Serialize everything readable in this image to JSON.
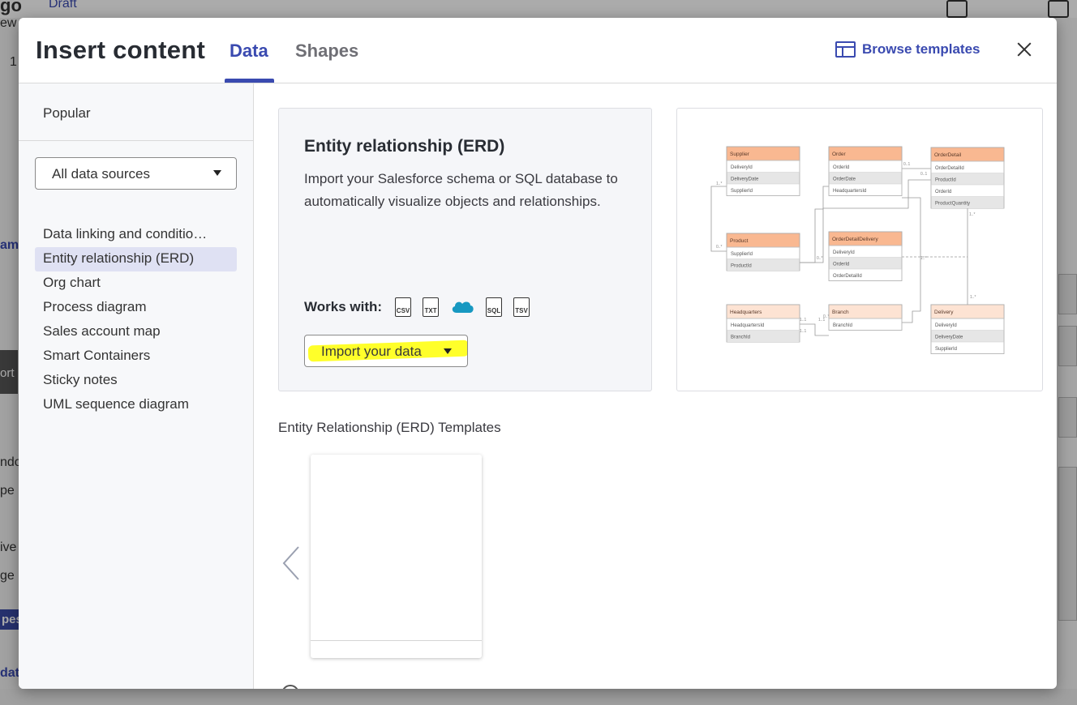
{
  "background": {
    "fragments": [
      "go",
      "Draft",
      "ew",
      "1",
      "am",
      "ort",
      "ndo",
      "pe",
      "ive",
      "ge",
      "pes",
      "dat"
    ]
  },
  "modal": {
    "title": "Insert content",
    "tabs": [
      {
        "label": "Data",
        "active": true
      },
      {
        "label": "Shapes",
        "active": false
      }
    ],
    "browse_templates": "Browse templates",
    "close_icon": "close-icon"
  },
  "sidebar": {
    "popular": "Popular",
    "source_select": "All data sources",
    "items": [
      {
        "label": "Data linking and conditio…",
        "active": false
      },
      {
        "label": "Entity relationship (ERD)",
        "active": true
      },
      {
        "label": "Org chart",
        "active": false
      },
      {
        "label": "Process diagram",
        "active": false
      },
      {
        "label": "Sales account map",
        "active": false
      },
      {
        "label": "Smart Containers",
        "active": false
      },
      {
        "label": "Sticky notes",
        "active": false
      },
      {
        "label": "UML sequence diagram",
        "active": false
      }
    ]
  },
  "feature": {
    "title": "Entity relationship (ERD)",
    "description": "Import your Salesforce schema or SQL database to automatically visualize objects and relationships.",
    "works_with_label": "Works with:",
    "formats": [
      "CSV",
      "TXT",
      "salesforce",
      "SQL",
      "TSV"
    ],
    "import_button": "Import your data",
    "highlight_color": "#ffff2a"
  },
  "erd_preview": {
    "tables": [
      {
        "name": "Supplier",
        "fields": [
          "DeliveryId",
          "DeliveryDate",
          "SupplierId"
        ]
      },
      {
        "name": "Order",
        "fields": [
          "OrderId",
          "OrderDate",
          "HeadquartersId"
        ]
      },
      {
        "name": "OrderDetail",
        "fields": [
          "OrderDetailId",
          "ProductId",
          "OrderId",
          "ProductQuantity"
        ]
      },
      {
        "name": "Product",
        "fields": [
          "SupplierId",
          "ProductId"
        ]
      },
      {
        "name": "OrderDetailDelivery",
        "fields": [
          "DeliveryId",
          "OrderId",
          "OrderDetailId"
        ]
      },
      {
        "name": "Headquarters",
        "fields": [
          "HeadquartersId",
          "BranchId"
        ]
      },
      {
        "name": "Branch",
        "fields": [
          "BranchId"
        ]
      },
      {
        "name": "Delivery",
        "fields": [
          "DeliveryId",
          "DeliveryDate",
          "SupplierId"
        ]
      }
    ],
    "cardinalities": [
      "1..*",
      "0..*",
      "0..1",
      "0..1",
      "1..*",
      "0..*",
      "1..*",
      "1..1",
      "1..1",
      "1..1",
      "0..*",
      "1..*"
    ]
  },
  "templates": {
    "title": "Entity Relationship (ERD) Templates"
  },
  "colors": {
    "accent": "#3a4ab0",
    "erd_header": "#f9b891",
    "erd_header_light": "#fde3d3"
  }
}
